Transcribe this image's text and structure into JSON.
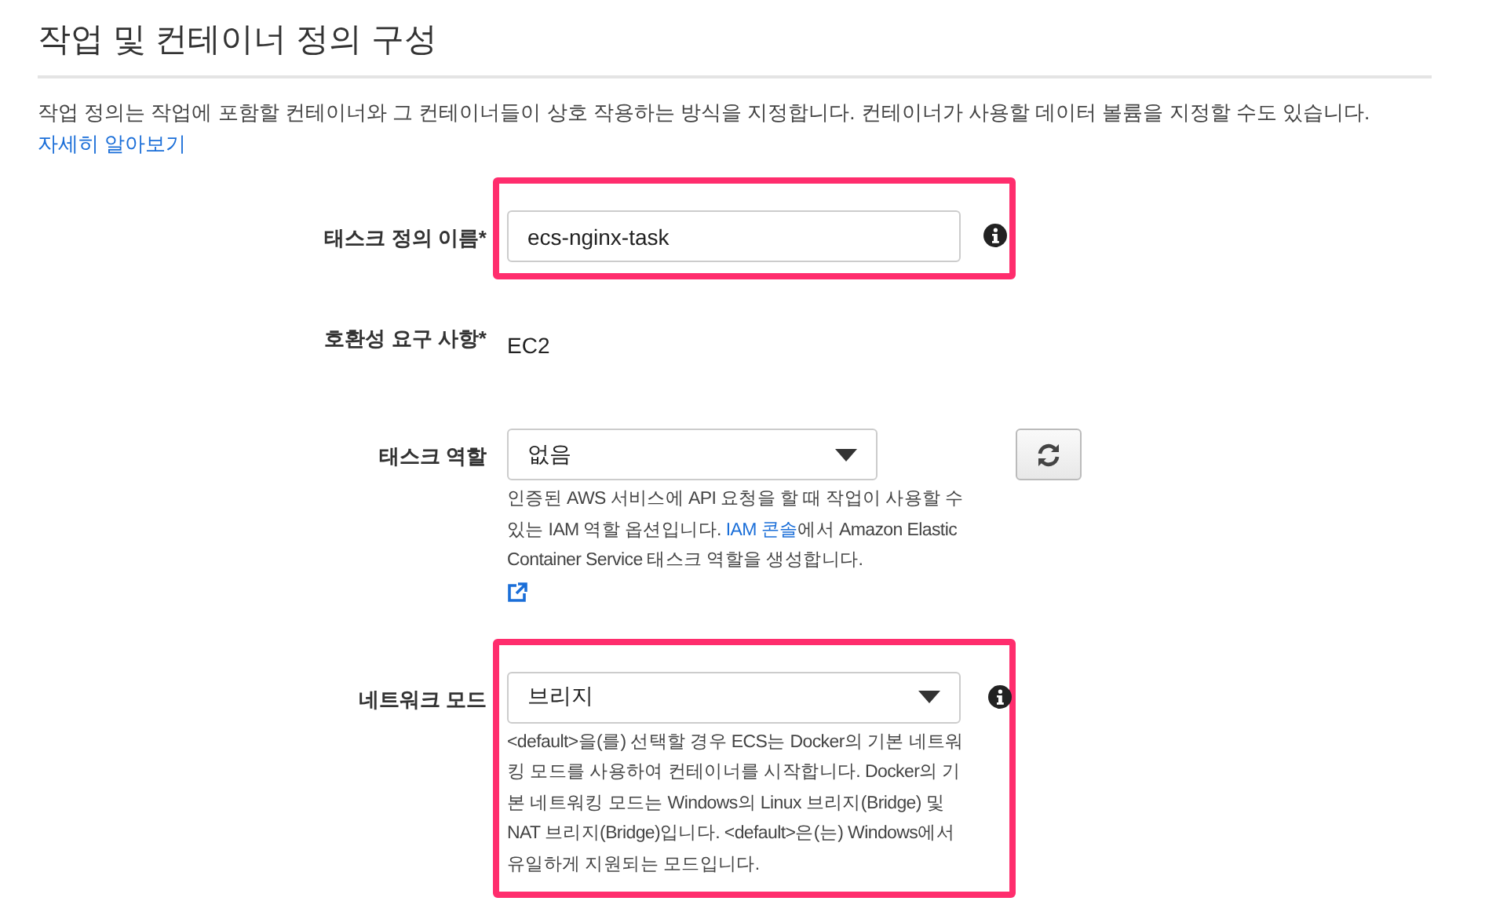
{
  "section": {
    "title": "작업 및 컨테이너 정의 구성",
    "description": "작업 정의는 작업에 포함할 컨테이너와 그 컨테이너들이 상호 작용하는 방식을 지정합니다. 컨테이너가 사용할 데이터 볼륨을 지정할 수도 있습니다.",
    "learn_more_link": "자세히 알아보기"
  },
  "fields": [
    {
      "kind": "text_input",
      "label": "태스크 정의 이름*",
      "value": "ecs-nginx-task",
      "info": true,
      "highlighted": true
    },
    {
      "kind": "static",
      "label": "호환성 요구 사항*",
      "value": "EC2",
      "info": false,
      "highlighted": false
    },
    {
      "kind": "select",
      "label": "태스크 역할",
      "value": "없음",
      "info": false,
      "highlighted": false,
      "refresh": true,
      "help": [
        {
          "kind": "text",
          "text": "인증된 AWS 서비스에 API 요청을 할 때 작업이 사용할 수 있는 IAM 역할 옵션입니다. "
        },
        {
          "kind": "link",
          "text": "IAM 콘솔"
        },
        {
          "kind": "text",
          "text": "에서 Amazon Elastic Container Service 태스크 역할을 생성합니다."
        }
      ],
      "external_link": true
    },
    {
      "kind": "select",
      "label": "네트워크 모드",
      "value": "브리지",
      "info": true,
      "highlighted": true,
      "refresh": false,
      "help": [
        {
          "kind": "text",
          "text": "<default>을(를) 선택할 경우 ECS는 Docker의 기본 네트워킹 모드를 사용하여 컨테이너를 시작합니다. Docker의 기본 네트워킹 모드는 Windows의 Linux 브리지(Bridge) 및 NAT 브리지(Bridge)입니다. <default>은(는) Windows에서 유일하게 지원되는 모드입니다."
        }
      ],
      "external_link": false
    }
  ]
}
